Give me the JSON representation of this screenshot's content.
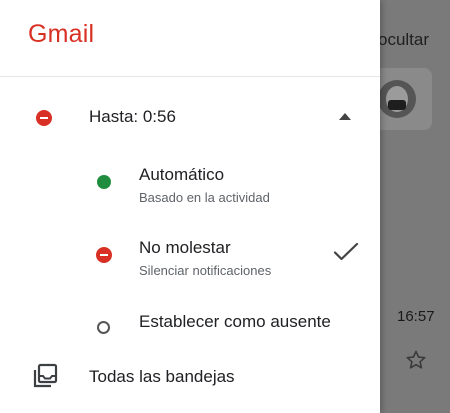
{
  "background": {
    "hide_label": "ocultar",
    "time": "16:57"
  },
  "drawer": {
    "brand": "Gmail",
    "status": {
      "label": "Hasta: 0:56"
    },
    "options": [
      {
        "title": "Automático",
        "subtitle": "Basado en la actividad"
      },
      {
        "title": "No molestar",
        "subtitle": "Silenciar notificaciones",
        "selected": true
      },
      {
        "title": "Establecer como ausente"
      }
    ],
    "inbox": {
      "label": "Todas las bandejas"
    }
  },
  "colors": {
    "brand": "#d93025",
    "active_green": "#1e8e3e",
    "dnd_red": "#d93025"
  }
}
